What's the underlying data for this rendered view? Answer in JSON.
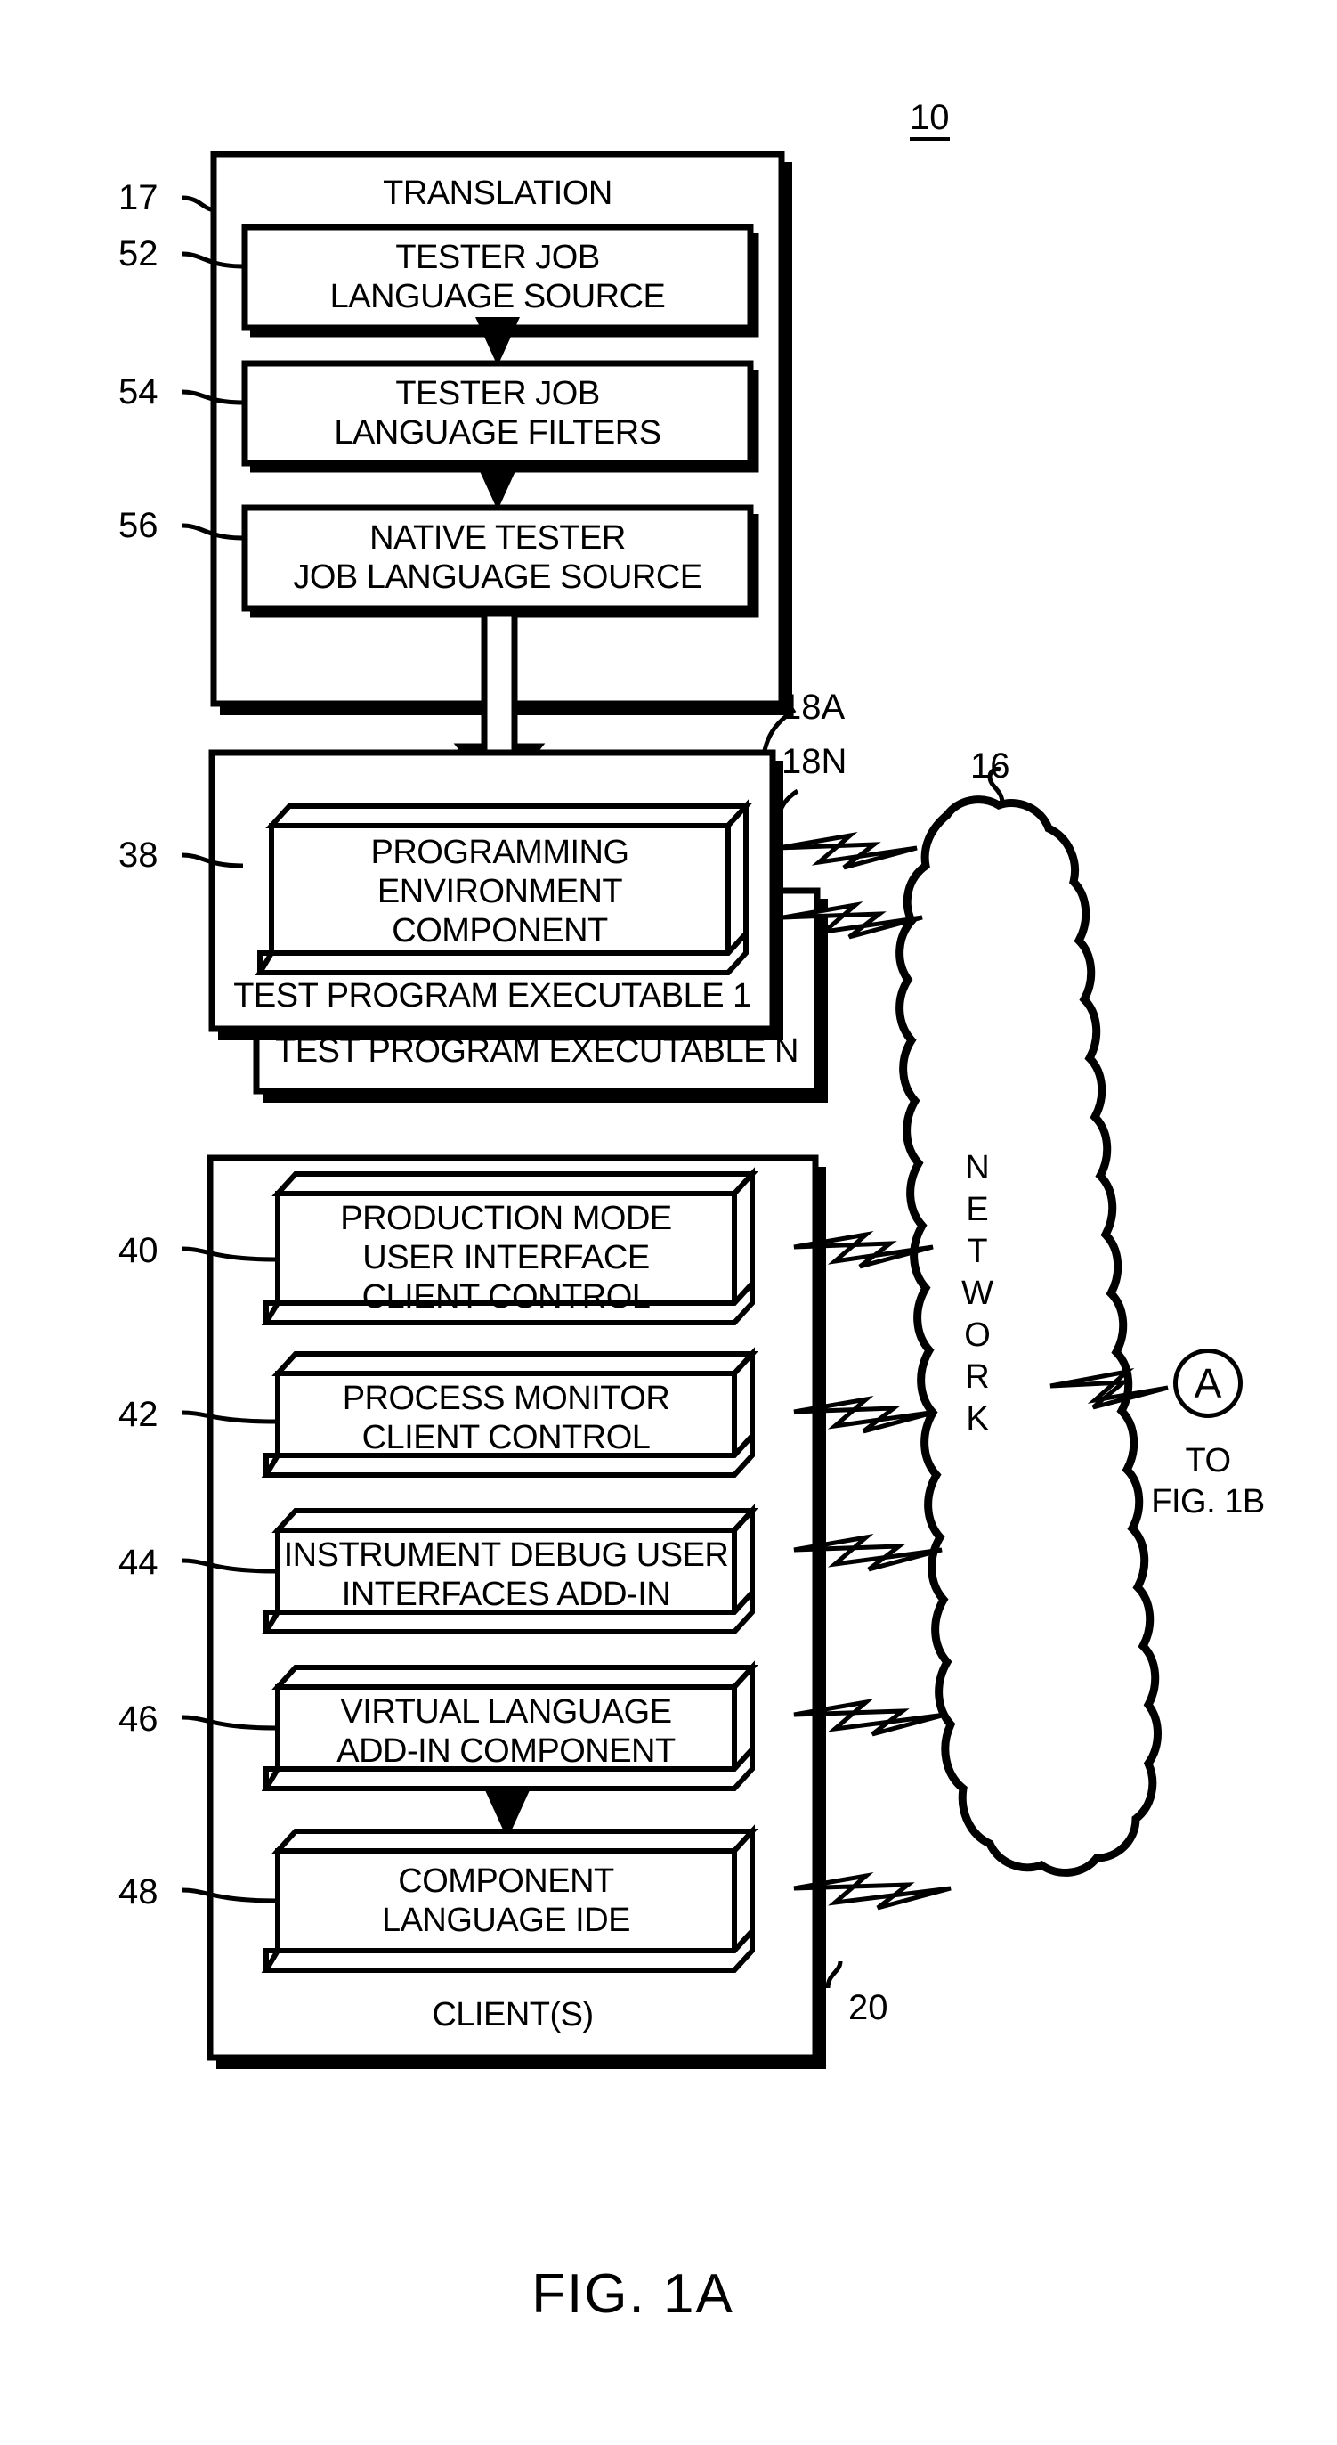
{
  "figure": {
    "caption": "FIG. 1A",
    "system_ref": "10"
  },
  "translation_group": {
    "ref": "17",
    "title": "TRANSLATION",
    "boxes": [
      {
        "ref": "52",
        "line1": "TESTER JOB",
        "line2": "LANGUAGE SOURCE"
      },
      {
        "ref": "54",
        "line1": "TESTER JOB",
        "line2": "LANGUAGE FILTERS"
      },
      {
        "ref": "56",
        "line1": "NATIVE TESTER",
        "line2": "JOB LANGUAGE SOURCE"
      }
    ]
  },
  "executable_group": {
    "ref_a": "18A",
    "ref_n": "18N",
    "component": {
      "ref": "38",
      "line1": "PROGRAMMING",
      "line2": "ENVIRONMENT",
      "line3": "COMPONENT"
    },
    "label_1": "TEST PROGRAM EXECUTABLE 1",
    "label_n": "TEST PROGRAM EXECUTABLE N"
  },
  "network": {
    "ref": "16",
    "label": "NETWORK",
    "letters": [
      "N",
      "E",
      "T",
      "W",
      "O",
      "R",
      "K"
    ]
  },
  "connector": {
    "symbol": "A",
    "line1": "TO",
    "line2": "FIG. 1B"
  },
  "client_group": {
    "ref": "20",
    "title": "CLIENT(S)",
    "boxes": [
      {
        "ref": "40",
        "line1": "PRODUCTION MODE",
        "line2": "USER INTERFACE",
        "line3": "CLIENT CONTROL"
      },
      {
        "ref": "42",
        "line1": "PROCESS MONITOR",
        "line2": "CLIENT CONTROL",
        "line3": ""
      },
      {
        "ref": "44",
        "line1": "INSTRUMENT DEBUG USER",
        "line2": "INTERFACES ADD-IN",
        "line3": ""
      },
      {
        "ref": "46",
        "line1": "VIRTUAL LANGUAGE",
        "line2": "ADD-IN COMPONENT",
        "line3": ""
      },
      {
        "ref": "48",
        "line1": "COMPONENT",
        "line2": "LANGUAGE IDE",
        "line3": ""
      }
    ]
  }
}
